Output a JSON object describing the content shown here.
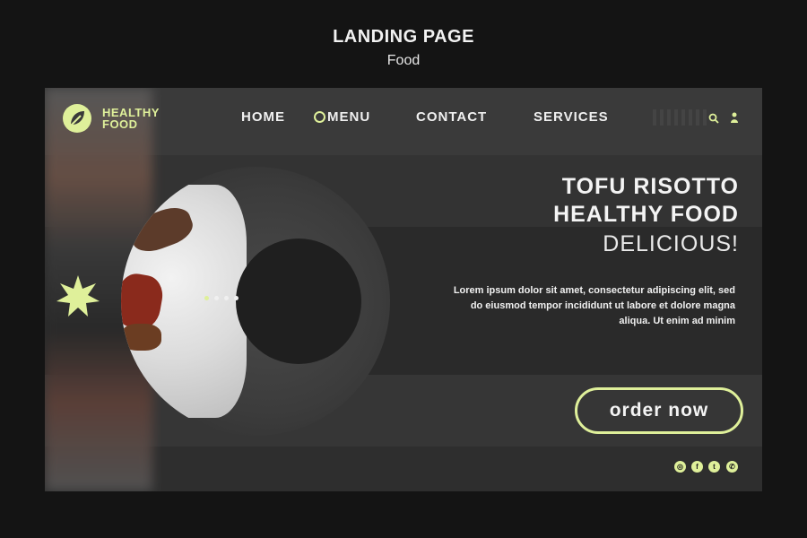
{
  "header": {
    "title": "LANDING PAGE",
    "subtitle": "Food"
  },
  "logo": {
    "line1": "HEALTHY",
    "line2": "FOOD"
  },
  "nav": {
    "home": "HOME",
    "menu": "MENU",
    "contact": "CONTACT",
    "services": "SERVICES"
  },
  "hero": {
    "title_line1": "TOFU RISOTTO",
    "title_line2": "HEALTHY FOOD",
    "tagline": "DELICIOUS!",
    "body": "Lorem ipsum dolor sit amet, consectetur adipiscing elit, sed do eiusmod tempor incididunt ut labore et dolore magna aliqua. Ut enim ad minim",
    "cta": "order now"
  },
  "social": {
    "instagram": "◎",
    "facebook": "f",
    "twitter": "t",
    "whatsapp": "✆"
  },
  "colors": {
    "accent": "#dff09a",
    "background": "#141414",
    "card": "#262626"
  }
}
